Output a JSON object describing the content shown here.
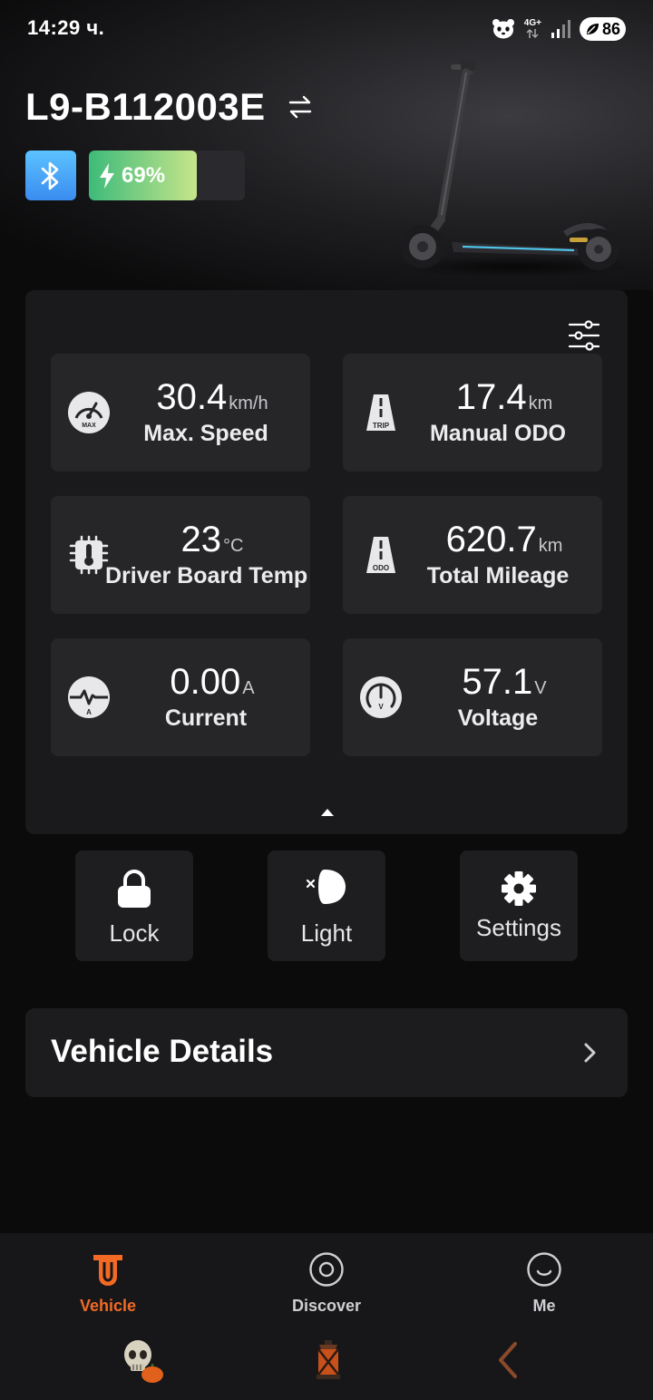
{
  "status_bar": {
    "time": "14:29 ч.",
    "network": "4G+",
    "battery_level": "86",
    "icons": [
      "panda-icon",
      "network-arrows-icon",
      "signal-icon",
      "battery-saver-leaf-icon"
    ]
  },
  "header": {
    "scooter_name": "L9-B112003E",
    "switch_icon": "swap-arrows-icon",
    "bluetooth_icon": "bluetooth-icon",
    "battery_percent_label": "69%",
    "battery_percent": 69,
    "charge_icon": "lightning-icon"
  },
  "stats": [
    {
      "icon": "speedometer-max-icon",
      "icon_text": "MAX",
      "value": "30.4",
      "unit": "km/h",
      "label": "Max. Speed"
    },
    {
      "icon": "road-trip-icon",
      "icon_text": "TRIP",
      "value": "17.4",
      "unit": "km",
      "label": "Manual ODO"
    },
    {
      "icon": "chip-thermometer-icon",
      "icon_text": "",
      "value": "23",
      "unit": "°C",
      "label": "Driver Board Temp"
    },
    {
      "icon": "road-odo-icon",
      "icon_text": "ODO",
      "value": "620.7",
      "unit": "km",
      "label": "Total Mileage"
    },
    {
      "icon": "current-ampere-icon",
      "icon_text": "A",
      "value": "0.00",
      "unit": "A",
      "label": "Current"
    },
    {
      "icon": "voltage-gauge-icon",
      "icon_text": "V",
      "value": "57.1",
      "unit": "V",
      "label": "Voltage"
    }
  ],
  "actions": [
    {
      "icon": "lock-icon",
      "label": "Lock"
    },
    {
      "icon": "light-off-icon",
      "label": "Light"
    },
    {
      "icon": "gear-icon",
      "label": "Settings"
    }
  ],
  "details": {
    "title": "Vehicle Details"
  },
  "tabs": [
    {
      "icon": "vehicle-icon",
      "label": "Vehicle",
      "active": true
    },
    {
      "icon": "discover-icon",
      "label": "Discover",
      "active": false
    },
    {
      "icon": "me-smile-icon",
      "label": "Me",
      "active": false
    }
  ],
  "system_nav": [
    "skull-pumpkin-icon",
    "lantern-icon",
    "back-chevron-icon"
  ],
  "colors": {
    "accent": "#f26a24",
    "bluetooth": "#4aa8f8",
    "battery_start": "#3dbb7a",
    "battery_end": "#c6e58a",
    "background": "#0b0b0c",
    "card": "#1a1a1c",
    "tile": "#262629"
  }
}
